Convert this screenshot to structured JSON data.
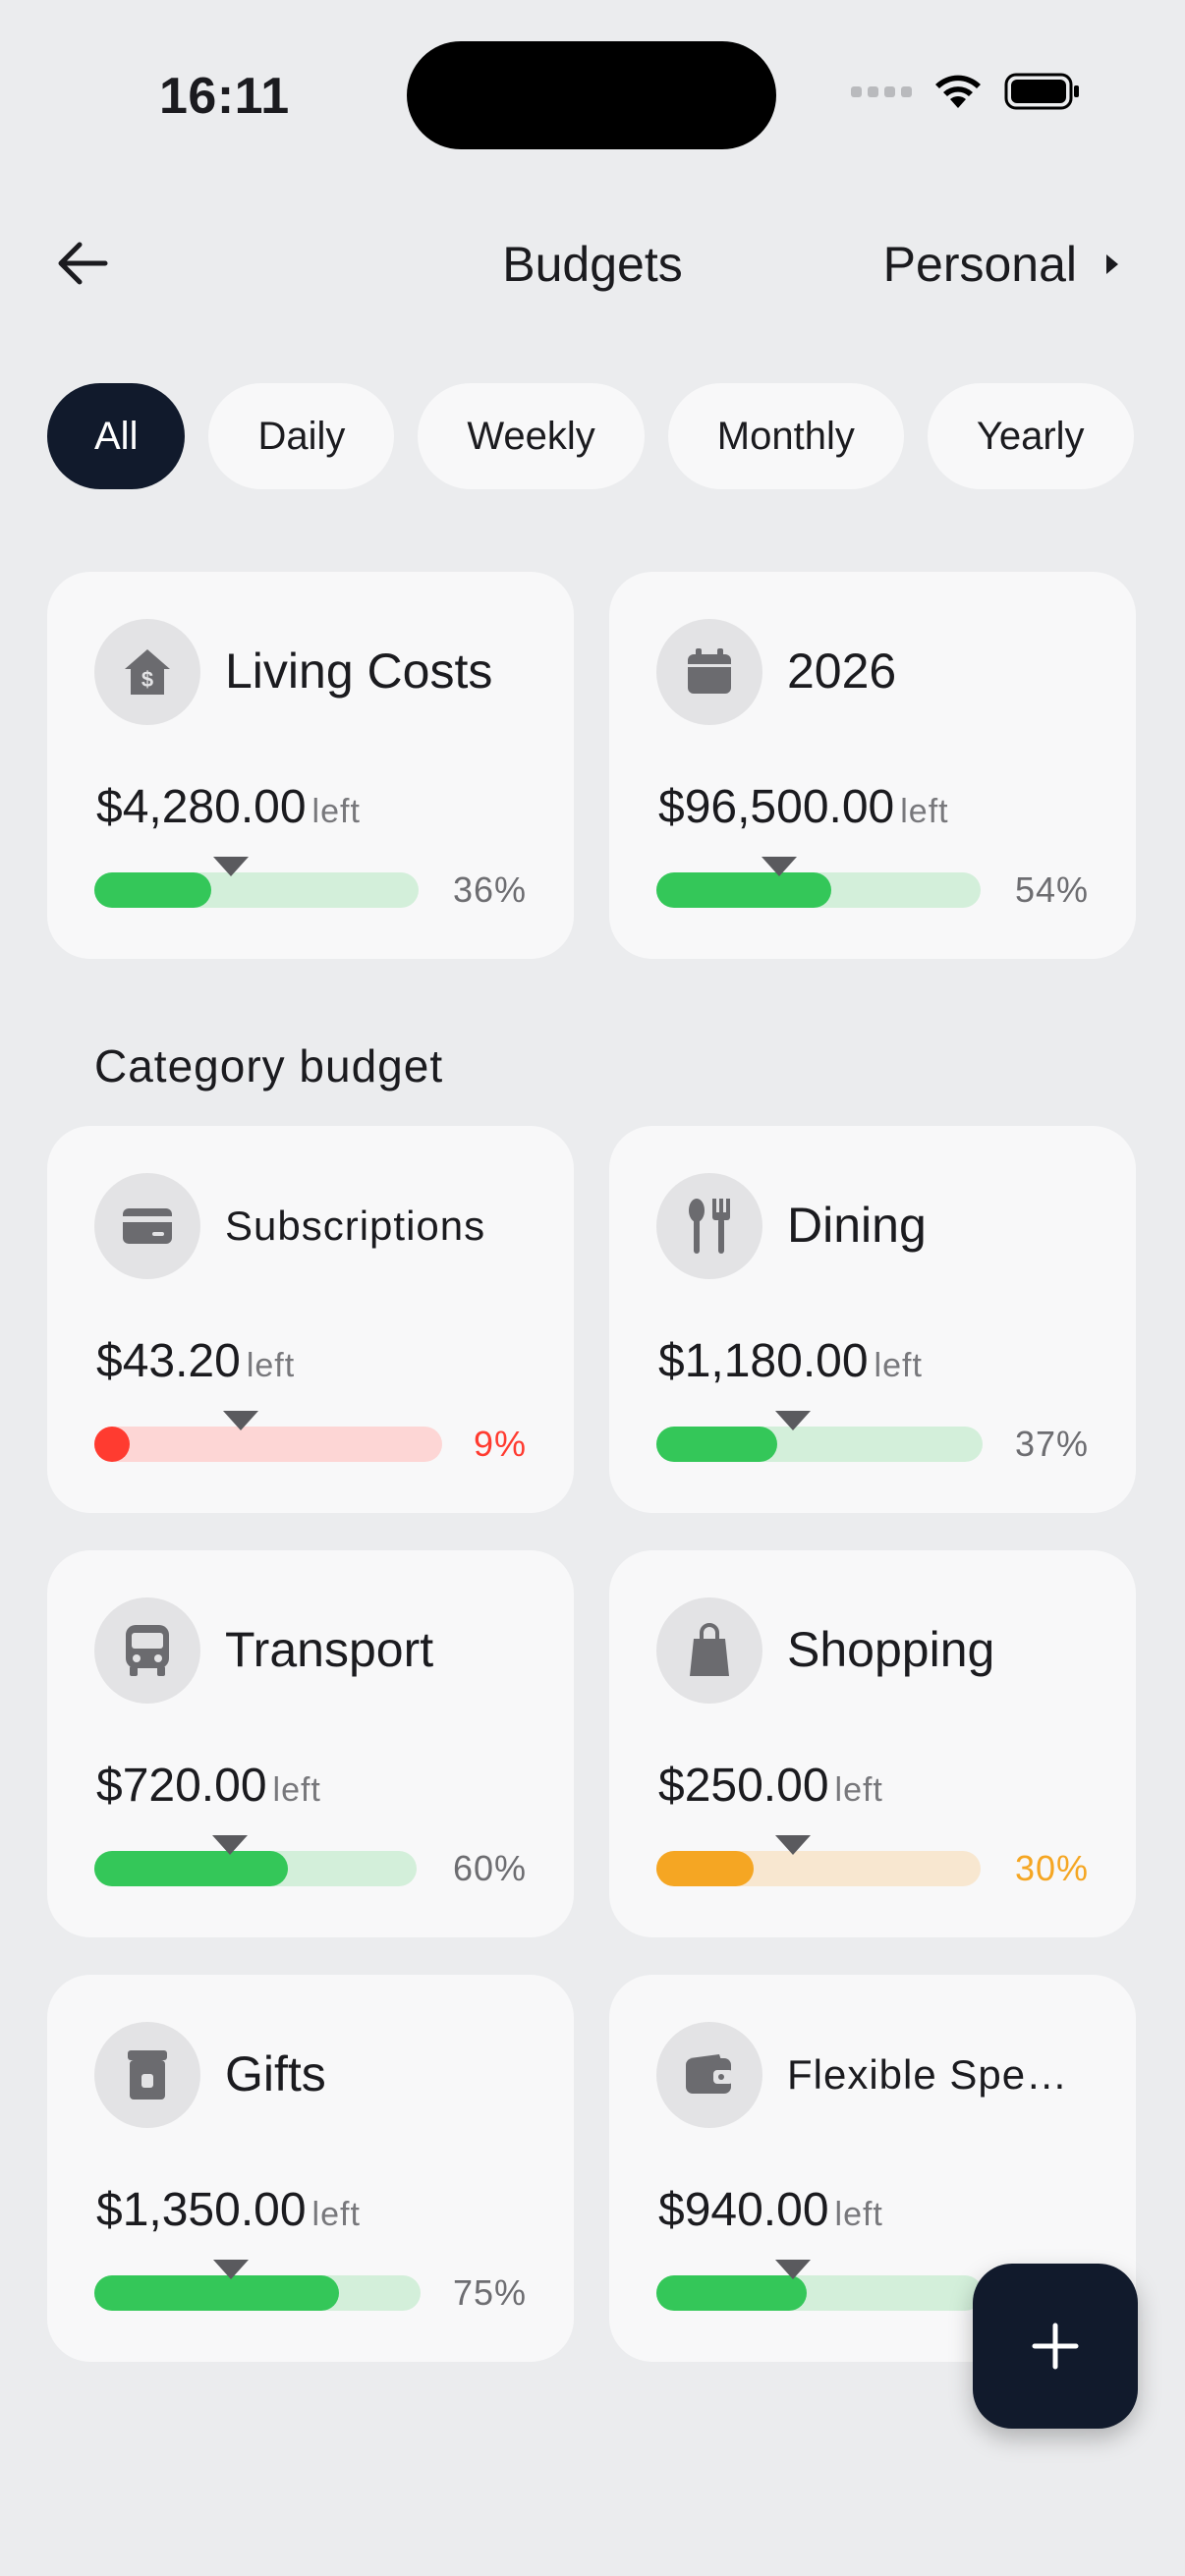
{
  "status_bar": {
    "time": "16:11"
  },
  "header": {
    "title": "Budgets",
    "account": "Personal"
  },
  "filters": [
    "All",
    "Daily",
    "Weekly",
    "Monthly",
    "Yearly"
  ],
  "active_filter": "All",
  "overview_cards": [
    {
      "name": "Living Costs",
      "icon": "house-dollar-icon",
      "amount": "$4,280.00",
      "left_label": "left",
      "percent": "36%",
      "progress": 0.36,
      "marker": 0.42,
      "status": "green"
    },
    {
      "name": "2026",
      "icon": "calendar-icon",
      "amount": "$96,500.00",
      "left_label": "left",
      "percent": "54%",
      "progress": 0.54,
      "marker": 0.38,
      "status": "green"
    }
  ],
  "category_section": {
    "title": "Category budget"
  },
  "category_cards": [
    {
      "name": "Subscriptions",
      "icon": "credit-card-icon",
      "amount": "$43.20",
      "left_label": "left",
      "percent": "9%",
      "progress": 0.05,
      "marker": 0.42,
      "status": "red"
    },
    {
      "name": "Dining",
      "icon": "fork-spoon-icon",
      "amount": "$1,180.00",
      "left_label": "left",
      "percent": "37%",
      "progress": 0.37,
      "marker": 0.42,
      "status": "green"
    },
    {
      "name": "Transport",
      "icon": "bus-icon",
      "amount": "$720.00",
      "left_label": "left",
      "percent": "60%",
      "progress": 0.6,
      "marker": 0.42,
      "status": "green"
    },
    {
      "name": "Shopping",
      "icon": "shopping-bag-icon",
      "amount": "$250.00",
      "left_label": "left",
      "percent": "30%",
      "progress": 0.3,
      "marker": 0.42,
      "status": "orange"
    },
    {
      "name": "Gifts",
      "icon": "gift-icon",
      "amount": "$1,350.00",
      "left_label": "left",
      "percent": "75%",
      "progress": 0.75,
      "marker": 0.42,
      "status": "green"
    },
    {
      "name": "Flexible Spe…",
      "icon": "wallet-icon",
      "amount": "$940.00",
      "left_label": "left",
      "percent": "",
      "progress": 0.46,
      "marker": 0.42,
      "status": "green"
    }
  ],
  "colors": {
    "green": "#34C759",
    "green_track": "#D3EFDA",
    "red": "#FF3B30",
    "red_track": "#FDD6D5",
    "orange": "#F5A623",
    "orange_track": "#F8E7D0",
    "dark": "#111A2C"
  },
  "fab": {
    "icon": "plus-icon"
  }
}
